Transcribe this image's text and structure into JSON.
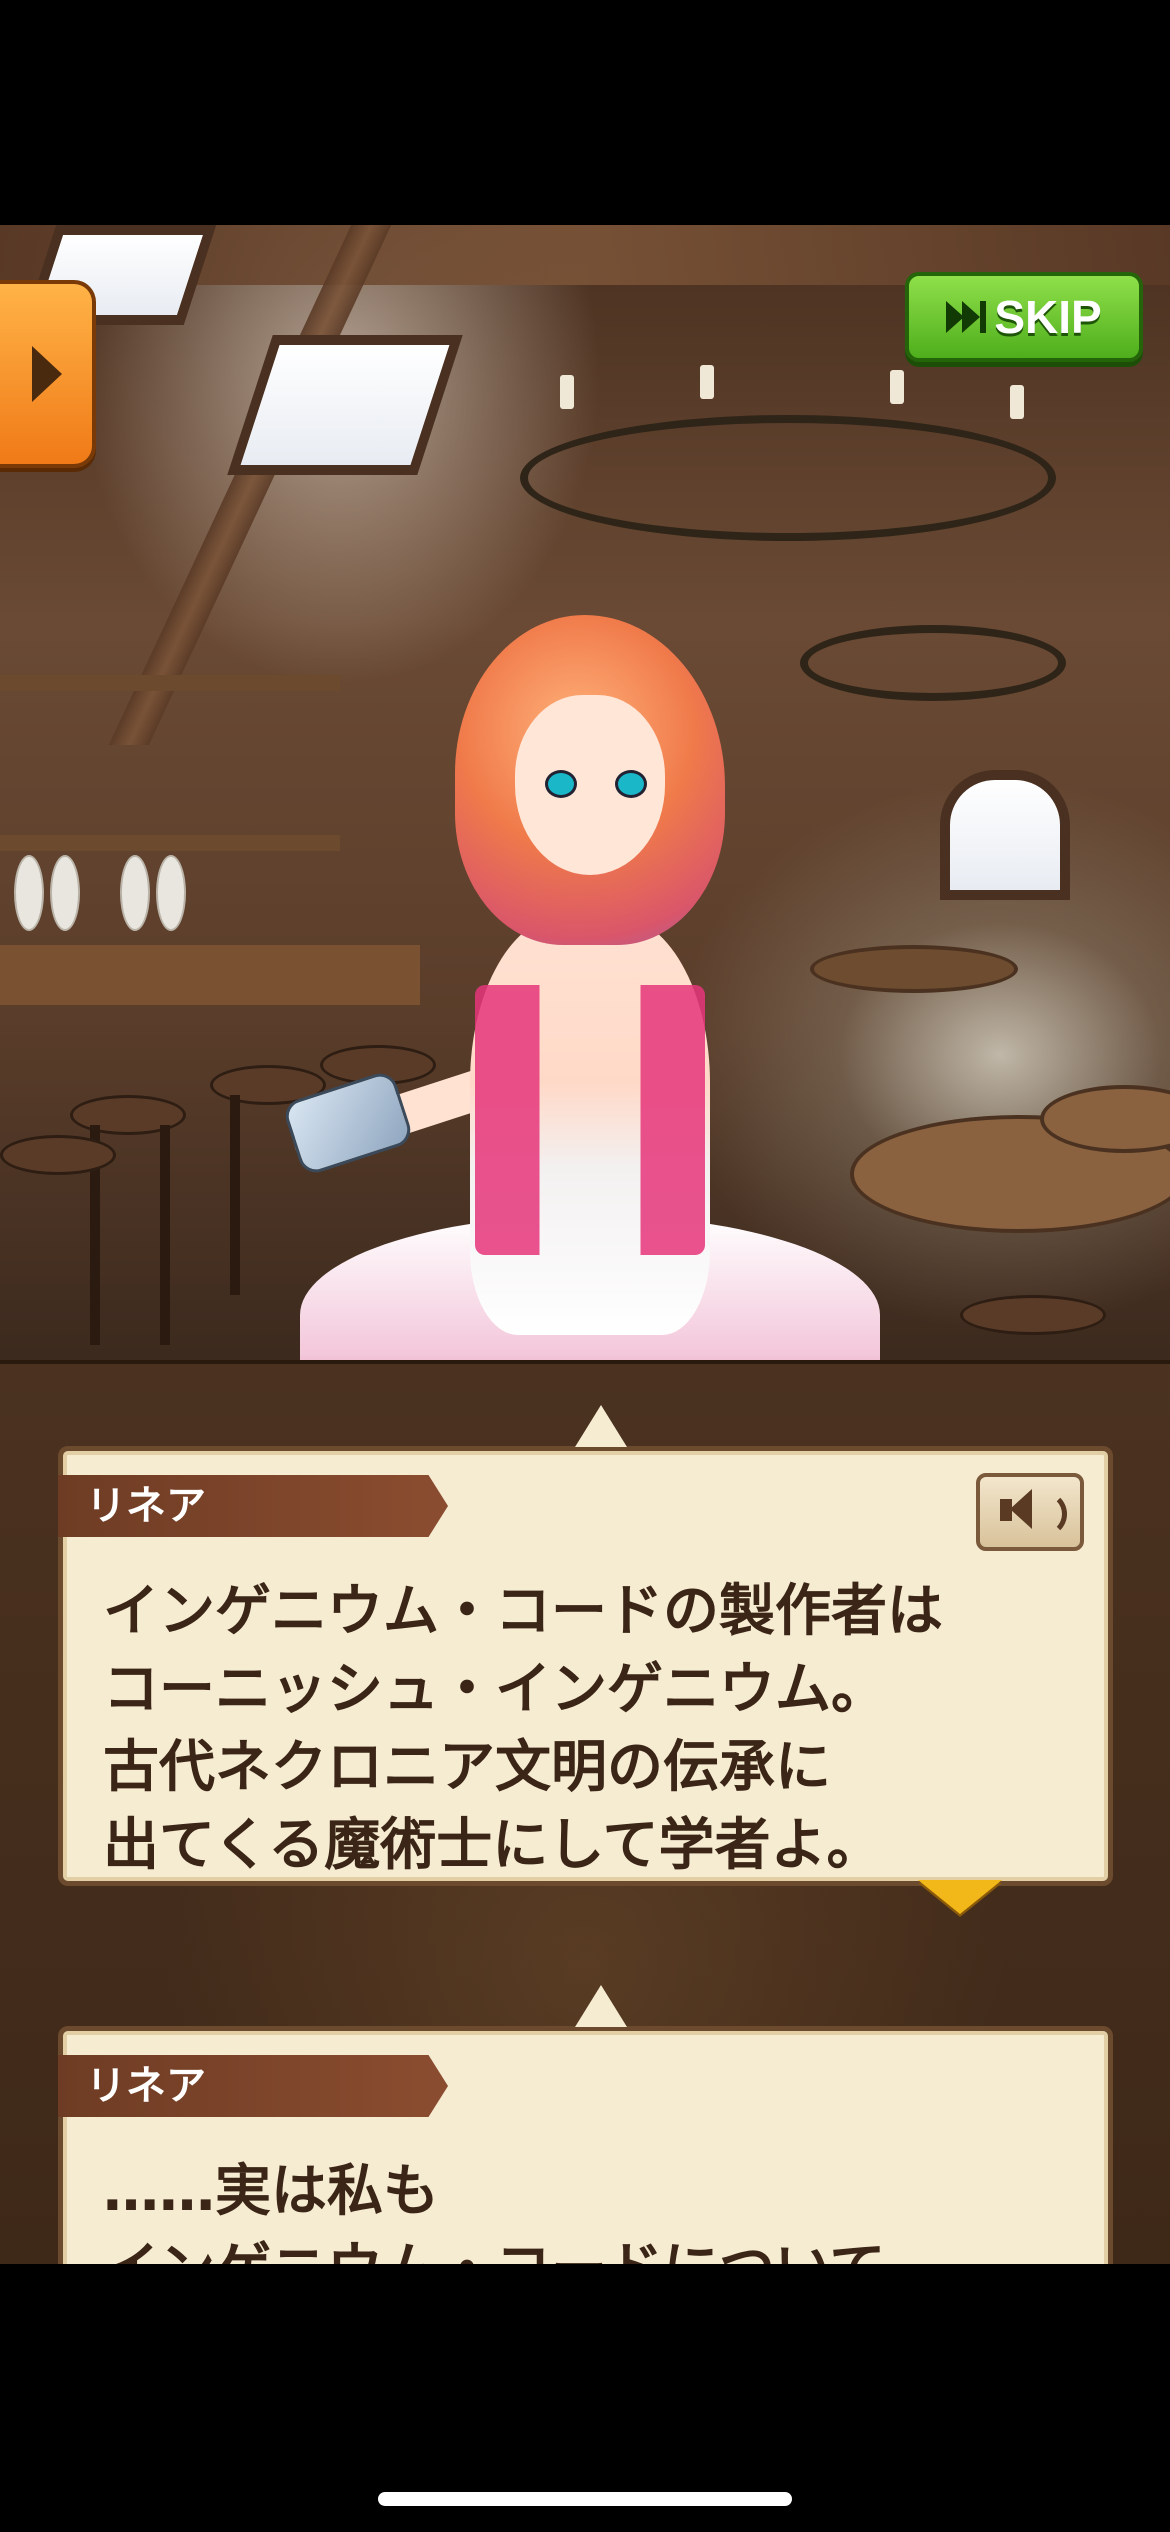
{
  "ui": {
    "skip_label": "SKIP"
  },
  "dialogs": [
    {
      "speaker": "リネア",
      "text": "インゲニウム・コードの製作者は\nコーニッシュ・インゲニウム。\n古代ネクロニア文明の伝承に\n出てくる魔術士にして学者よ。"
    },
    {
      "speaker": "リネア",
      "text": "……実は私も\nインゲニウム・コードについて"
    }
  ],
  "colors": {
    "skip_green": "#4fae1c",
    "tab_orange": "#f07a17",
    "panel_parchment": "#f6ecd2",
    "nameplate_brown": "#6e3c24",
    "advance_arrow": "#f2b81a"
  },
  "icons": [
    "menu-arrow-icon",
    "fast-forward-icon",
    "speaker-icon",
    "advance-arrow-icon"
  ]
}
